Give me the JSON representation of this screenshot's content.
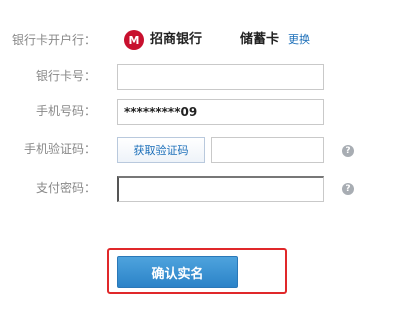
{
  "form": {
    "bank_label": "银行卡开户行：",
    "bank_logo_text": "M",
    "bank_name": "招商银行",
    "card_type": "储蓄卡",
    "change_link": "更换",
    "card_number_label": "银行卡号：",
    "card_number_value": "",
    "phone_label": "手机号码：",
    "phone_value": "*********09",
    "sms_code_label": "手机验证码：",
    "get_code_button": "获取验证码",
    "sms_code_value": "",
    "password_label": "支付密码：",
    "password_value": "",
    "help_icon_glyph": "?",
    "confirm_button": "确认实名"
  },
  "colors": {
    "bank_red": "#c8102e",
    "link_blue": "#1c6fb9",
    "button_blue": "#2b83c8",
    "highlight_red": "#e0282a"
  },
  "icons": {
    "bank": "cmb-bank-logo-icon",
    "help": "question-mark-icon"
  }
}
